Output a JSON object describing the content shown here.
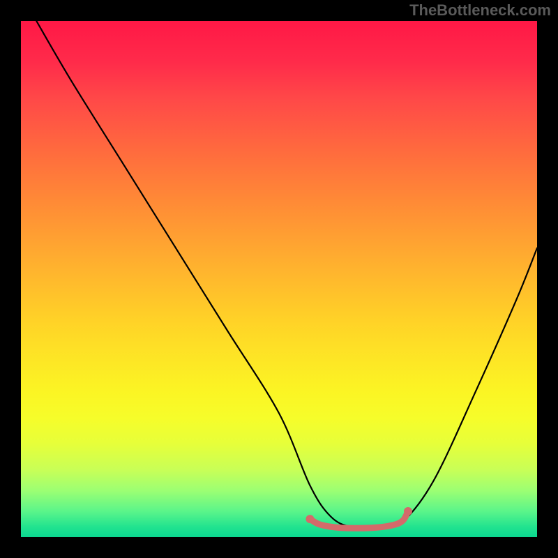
{
  "watermark": "TheBottleneck.com",
  "chart_data": {
    "type": "line",
    "title": "",
    "xlabel": "",
    "ylabel": "",
    "xlim": [
      0,
      100
    ],
    "ylim": [
      0,
      100
    ],
    "grid": false,
    "series": [
      {
        "name": "bottleneck-curve",
        "color": "#000000",
        "x": [
          3,
          10,
          20,
          30,
          40,
          50,
          56,
          60,
          64,
          70,
          74,
          80,
          88,
          96,
          100
        ],
        "y": [
          100,
          88,
          72,
          56,
          40,
          24,
          10,
          4,
          2,
          2,
          3,
          11,
          28,
          46,
          56
        ]
      },
      {
        "name": "optimal-segment",
        "color": "#d46a6a",
        "x": [
          56,
          58,
          62,
          68,
          72,
          74,
          75
        ],
        "y": [
          3.5,
          2.4,
          1.8,
          1.8,
          2.3,
          3.2,
          5
        ]
      }
    ],
    "gradient_stops": [
      {
        "pos": 0,
        "color": "#ff1846"
      },
      {
        "pos": 15,
        "color": "#ff4848"
      },
      {
        "pos": 35,
        "color": "#ff8a36"
      },
      {
        "pos": 58,
        "color": "#ffd227"
      },
      {
        "pos": 72,
        "color": "#fbf524"
      },
      {
        "pos": 87,
        "color": "#c8ff57"
      },
      {
        "pos": 100,
        "color": "#0bd890"
      }
    ]
  }
}
